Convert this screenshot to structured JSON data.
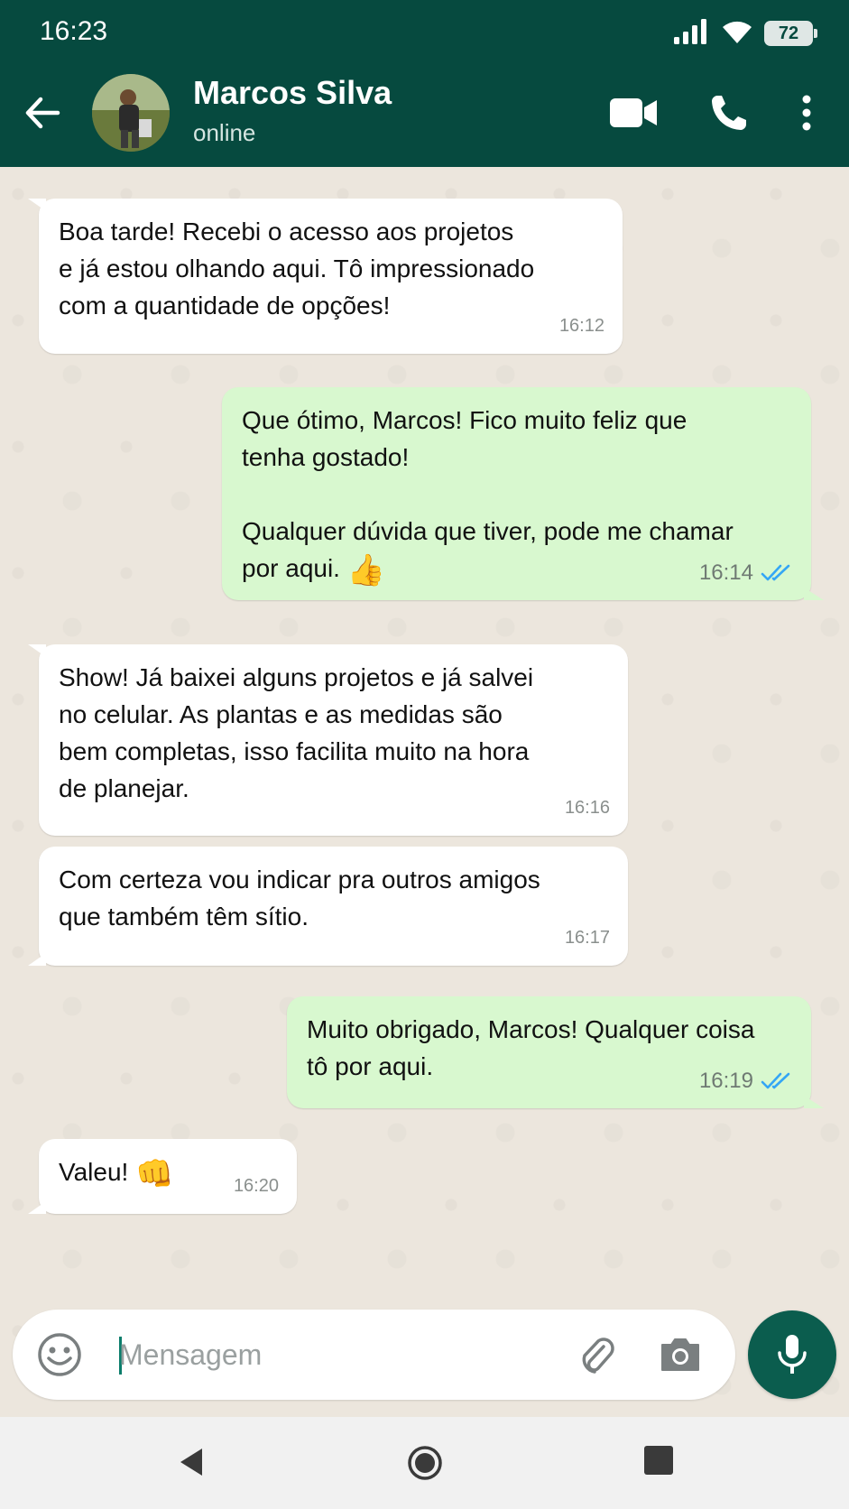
{
  "status_bar": {
    "time": "16:23",
    "battery": "72"
  },
  "header": {
    "contact_name": "Marcos Silva",
    "contact_status": "online"
  },
  "messages": [
    {
      "direction": "incoming",
      "text": "Boa tarde! Recebi o acesso aos projetos\ne já estou olhando aqui. Tô impressionado\ncom a quantidade de opções!",
      "time": "16:12"
    },
    {
      "direction": "outgoing",
      "text": "Que ótimo, Marcos! Fico muito feliz que\ntenha gostado!\n\nQualquer dúvida que tiver, pode me chamar\npor aqui.",
      "emoji": "👍",
      "time": "16:14",
      "status": "read"
    },
    {
      "direction": "incoming",
      "text": "Show! Já baixei alguns projetos e já salvei\nno celular. As plantas e as medidas são\nbem completas, isso facilita muito na hora\nde planejar.",
      "time": "16:16"
    },
    {
      "direction": "incoming",
      "text": "Com certeza vou indicar pra outros amigos\nque também têm sítio.",
      "time": "16:17"
    },
    {
      "direction": "outgoing",
      "text": "Muito obrigado, Marcos! Qualquer coisa\ntô por aqui.",
      "time": "16:19",
      "status": "read"
    },
    {
      "direction": "incoming",
      "text": "Valeu!",
      "emoji": "👊",
      "time": "16:20"
    }
  ],
  "composer": {
    "placeholder": "Mensagem",
    "value": ""
  },
  "colors": {
    "header_bg": "#064a3f",
    "incoming_bubble": "#ffffff",
    "outgoing_bubble": "#d8f8cf",
    "read_ticks": "#34a6f5",
    "mic_button": "#0b5d4e"
  },
  "icons": [
    "back-arrow-icon",
    "video-call-icon",
    "phone-icon",
    "more-options-icon",
    "emoji-icon",
    "attach-icon",
    "camera-icon",
    "mic-icon",
    "read-receipt-icon"
  ]
}
